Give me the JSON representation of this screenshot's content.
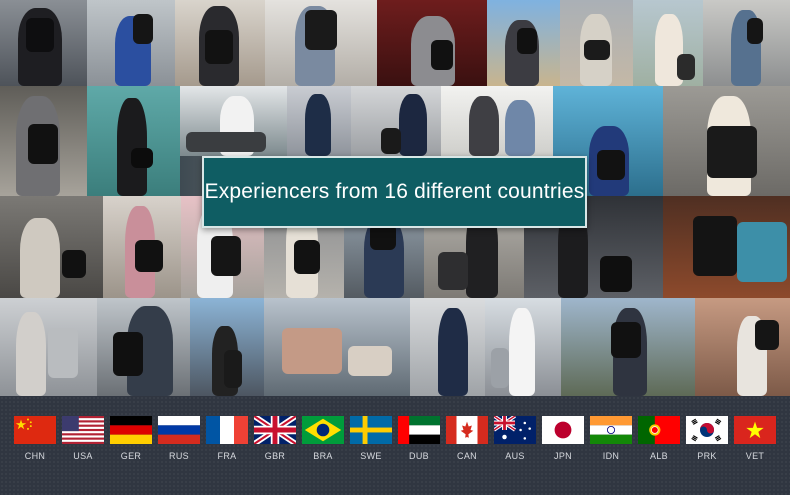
{
  "banner": {
    "text": "Experiencers from 16 different countries"
  },
  "flags": [
    {
      "code": "CHN",
      "icon": "china-flag-icon"
    },
    {
      "code": "USA",
      "icon": "usa-flag-icon"
    },
    {
      "code": "GER",
      "icon": "germany-flag-icon"
    },
    {
      "code": "RUS",
      "icon": "russia-flag-icon"
    },
    {
      "code": "FRA",
      "icon": "france-flag-icon"
    },
    {
      "code": "GBR",
      "icon": "uk-flag-icon"
    },
    {
      "code": "BRA",
      "icon": "brazil-flag-icon"
    },
    {
      "code": "SWE",
      "icon": "sweden-flag-icon"
    },
    {
      "code": "DUB",
      "icon": "uae-flag-icon"
    },
    {
      "code": "CAN",
      "icon": "canada-flag-icon"
    },
    {
      "code": "AUS",
      "icon": "australia-flag-icon"
    },
    {
      "code": "JPN",
      "icon": "japan-flag-icon"
    },
    {
      "code": "IDN",
      "icon": "india-flag-icon"
    },
    {
      "code": "ALB",
      "icon": "portugal-flag-icon"
    },
    {
      "code": "PRK",
      "icon": "korea-flag-icon"
    },
    {
      "code": "VET",
      "icon": "vietnam-flag-icon"
    }
  ]
}
